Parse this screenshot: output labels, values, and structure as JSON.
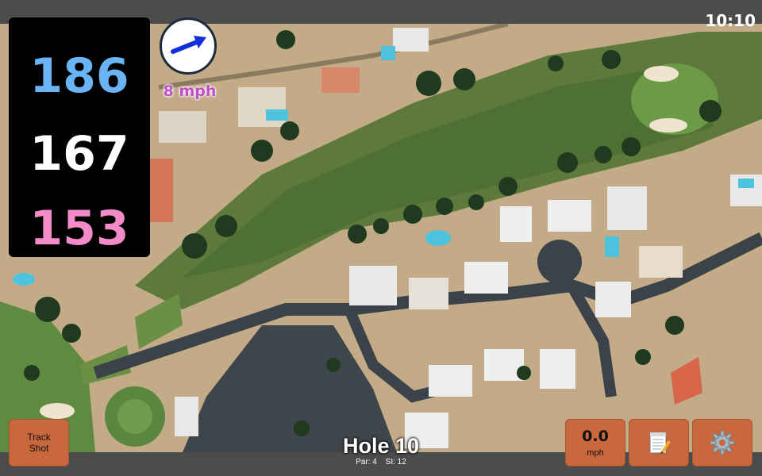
{
  "status_bar": {
    "time": "10:10"
  },
  "distances": {
    "back": "186",
    "center": "167",
    "front": "153"
  },
  "wind": {
    "speed": "8 mph",
    "icon": "arrow-icon"
  },
  "hole": {
    "title": "Hole 10",
    "par": "Par: 4",
    "si": "SI: 12"
  },
  "buttons": {
    "track_shot_line1": "Track",
    "track_shot_line2": "Shot",
    "speed_value": "0.0",
    "speed_unit": "mph",
    "notes_icon": "notepad-icon",
    "settings_icon": "gear-icon"
  },
  "colors": {
    "back": "#6ab3f4",
    "center": "#ffffff",
    "front": "#f38bc8",
    "wind": "#c04ec4",
    "button": "#c8683c"
  }
}
